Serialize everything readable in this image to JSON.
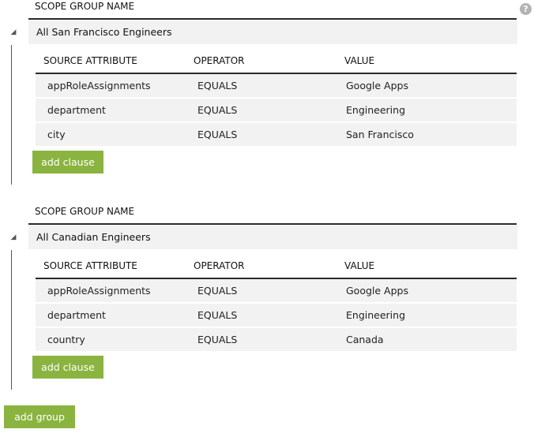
{
  "help_icon_glyph": "?",
  "toggle_glyph": "◢",
  "groups": [
    {
      "scope_header": "SCOPE GROUP NAME",
      "name": "All San Francisco Engineers",
      "columns": [
        "SOURCE ATTRIBUTE",
        "OPERATOR",
        "VALUE"
      ],
      "rows": [
        [
          "appRoleAssignments",
          "EQUALS",
          "Google Apps"
        ],
        [
          "department",
          "EQUALS",
          "Engineering"
        ],
        [
          "city",
          "EQUALS",
          "San Francisco"
        ]
      ],
      "add_clause_label": "add clause"
    },
    {
      "scope_header": "SCOPE GROUP NAME",
      "name": "All Canadian Engineers",
      "columns": [
        "SOURCE ATTRIBUTE",
        "OPERATOR",
        "VALUE"
      ],
      "rows": [
        [
          "appRoleAssignments",
          "EQUALS",
          "Google Apps"
        ],
        [
          "department",
          "EQUALS",
          "Engineering"
        ],
        [
          "country",
          "EQUALS",
          "Canada"
        ]
      ],
      "add_clause_label": "add clause"
    }
  ],
  "add_group_label": "add group",
  "colors": {
    "accent_green": "#8ab43f",
    "row_bg": "#f2f2f2"
  },
  "icons": [
    "help-icon",
    "collapse-toggle-icon"
  ]
}
